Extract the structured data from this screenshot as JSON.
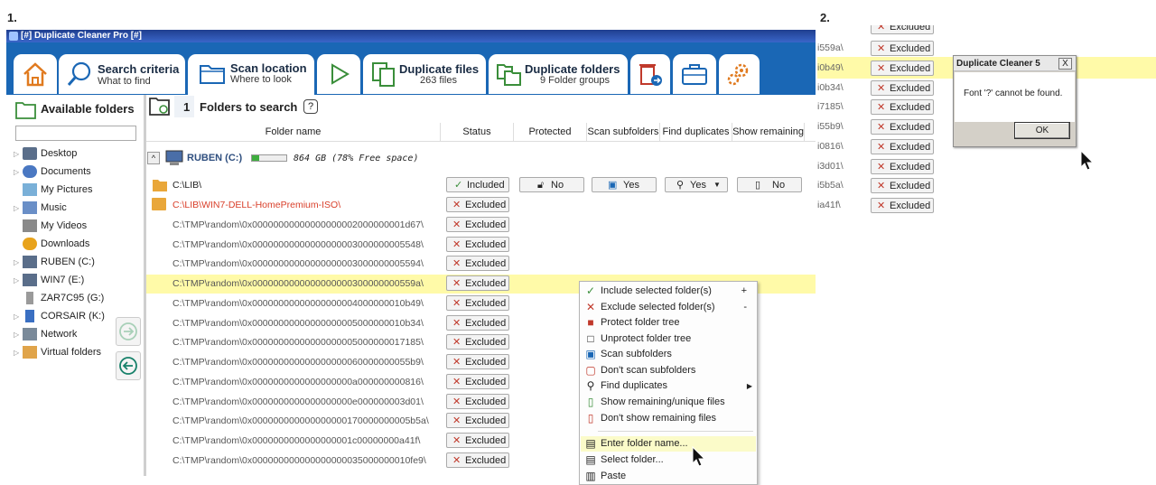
{
  "labels": {
    "step1": "1.",
    "step2": "2."
  },
  "window": {
    "title": "[#] Duplicate Cleaner Pro [#]"
  },
  "ribbon": {
    "home_icon": "home-icon",
    "tabs": [
      {
        "title": "Search criteria",
        "subtitle": "What to find"
      },
      {
        "title": "Scan location",
        "subtitle": "Where to look"
      },
      {
        "title": "Duplicate files",
        "subtitle": "263 files"
      },
      {
        "title": "Duplicate folders",
        "subtitle": "9 Folder groups"
      }
    ],
    "accent": "#1a67b5"
  },
  "left": {
    "title": "Available folders",
    "tree": [
      "Desktop",
      "Documents",
      "My Pictures",
      "Music",
      "My Videos",
      "Downloads",
      "RUBEN (C:)",
      "WIN7 (E:)",
      "ZAR7C95 (G:)",
      "CORSAIR (K:)",
      "Network",
      "Virtual folders"
    ]
  },
  "right": {
    "count": "1",
    "title": "Folders to search",
    "help": "?",
    "columns": [
      "Folder name",
      "Status",
      "Protected",
      "Scan subfolders",
      "Find duplicates",
      "Show remaining"
    ],
    "drive": {
      "name": "RUBEN (C:)",
      "space": "864 GB (78% Free space)",
      "used_fraction": 0.22,
      "expand": "^"
    },
    "first_row": {
      "path": "C:\\LIB\\",
      "status": "Included",
      "protected": "No",
      "scan": "Yes",
      "find": "Yes",
      "show": "No"
    },
    "excluded_label": "Excluded",
    "rows": [
      "C:\\LIB\\WIN7-DELL-HomePremium-ISO\\",
      "C:\\TMP\\random\\0x00000000000000000002000000001d67\\",
      "C:\\TMP\\random\\0x00000000000000000003000000005548\\",
      "C:\\TMP\\random\\0x00000000000000000003000000005594\\",
      "C:\\TMP\\random\\0x0000000000000000000300000000559a\\",
      "C:\\TMP\\random\\0x00000000000000000004000000010b49\\",
      "C:\\TMP\\random\\0x00000000000000000005000000010b34\\",
      "C:\\TMP\\random\\0x00000000000000000005000000017185\\",
      "C:\\TMP\\random\\0x000000000000000000060000000055b9\\",
      "C:\\TMP\\random\\0x0000000000000000000a000000000816\\",
      "C:\\TMP\\random\\0x0000000000000000000e000000003d01\\",
      "C:\\TMP\\random\\0x000000000000000000170000000005b5a\\",
      "C:\\TMP\\random\\0x0000000000000000001c00000000a41f\\",
      "C:\\TMP\\random\\0x000000000000000000035000000010fe9\\"
    ],
    "red_row_color": "#d9402b",
    "highlight_color": "#fffaa8"
  },
  "context_menu": {
    "items": [
      {
        "label": "Include selected folder(s)",
        "shortcut": "+",
        "icon": "check-icon"
      },
      {
        "label": "Exclude selected folder(s)",
        "shortcut": "-",
        "icon": "x-icon"
      },
      {
        "label": "Protect folder tree",
        "icon": "lock-icon"
      },
      {
        "label": "Unprotect folder tree",
        "icon": "unlock-icon"
      },
      {
        "label": "Scan subfolders",
        "icon": "folder-tree-icon"
      },
      {
        "label": "Don't scan subfolders",
        "icon": "folder-x-icon"
      },
      {
        "label": "Find duplicates",
        "icon": "magnifier-icon",
        "submenu": true
      },
      {
        "label": "Show remaining/unique files",
        "icon": "file-icon"
      },
      {
        "label": "Don't show remaining files",
        "icon": "file-x-icon"
      },
      {
        "label": "Enter folder name...",
        "icon": "folder-edit-icon"
      },
      {
        "label": "Select folder...",
        "icon": "folder-open-icon"
      },
      {
        "label": "Paste",
        "icon": "paste-icon"
      }
    ]
  },
  "panel2": {
    "rows": [
      "i559a\\",
      "i0b49\\",
      "i0b34\\",
      "i7185\\",
      "i55b9\\",
      "i0816\\",
      "i3d01\\",
      "i5b5a\\",
      "ia41f\\"
    ],
    "top_cut_label": "Excluded",
    "excluded_label": "Excluded"
  },
  "dialog": {
    "title": "Duplicate Cleaner 5",
    "close": "X",
    "message": "Font '?' cannot be found.",
    "ok": "OK"
  }
}
